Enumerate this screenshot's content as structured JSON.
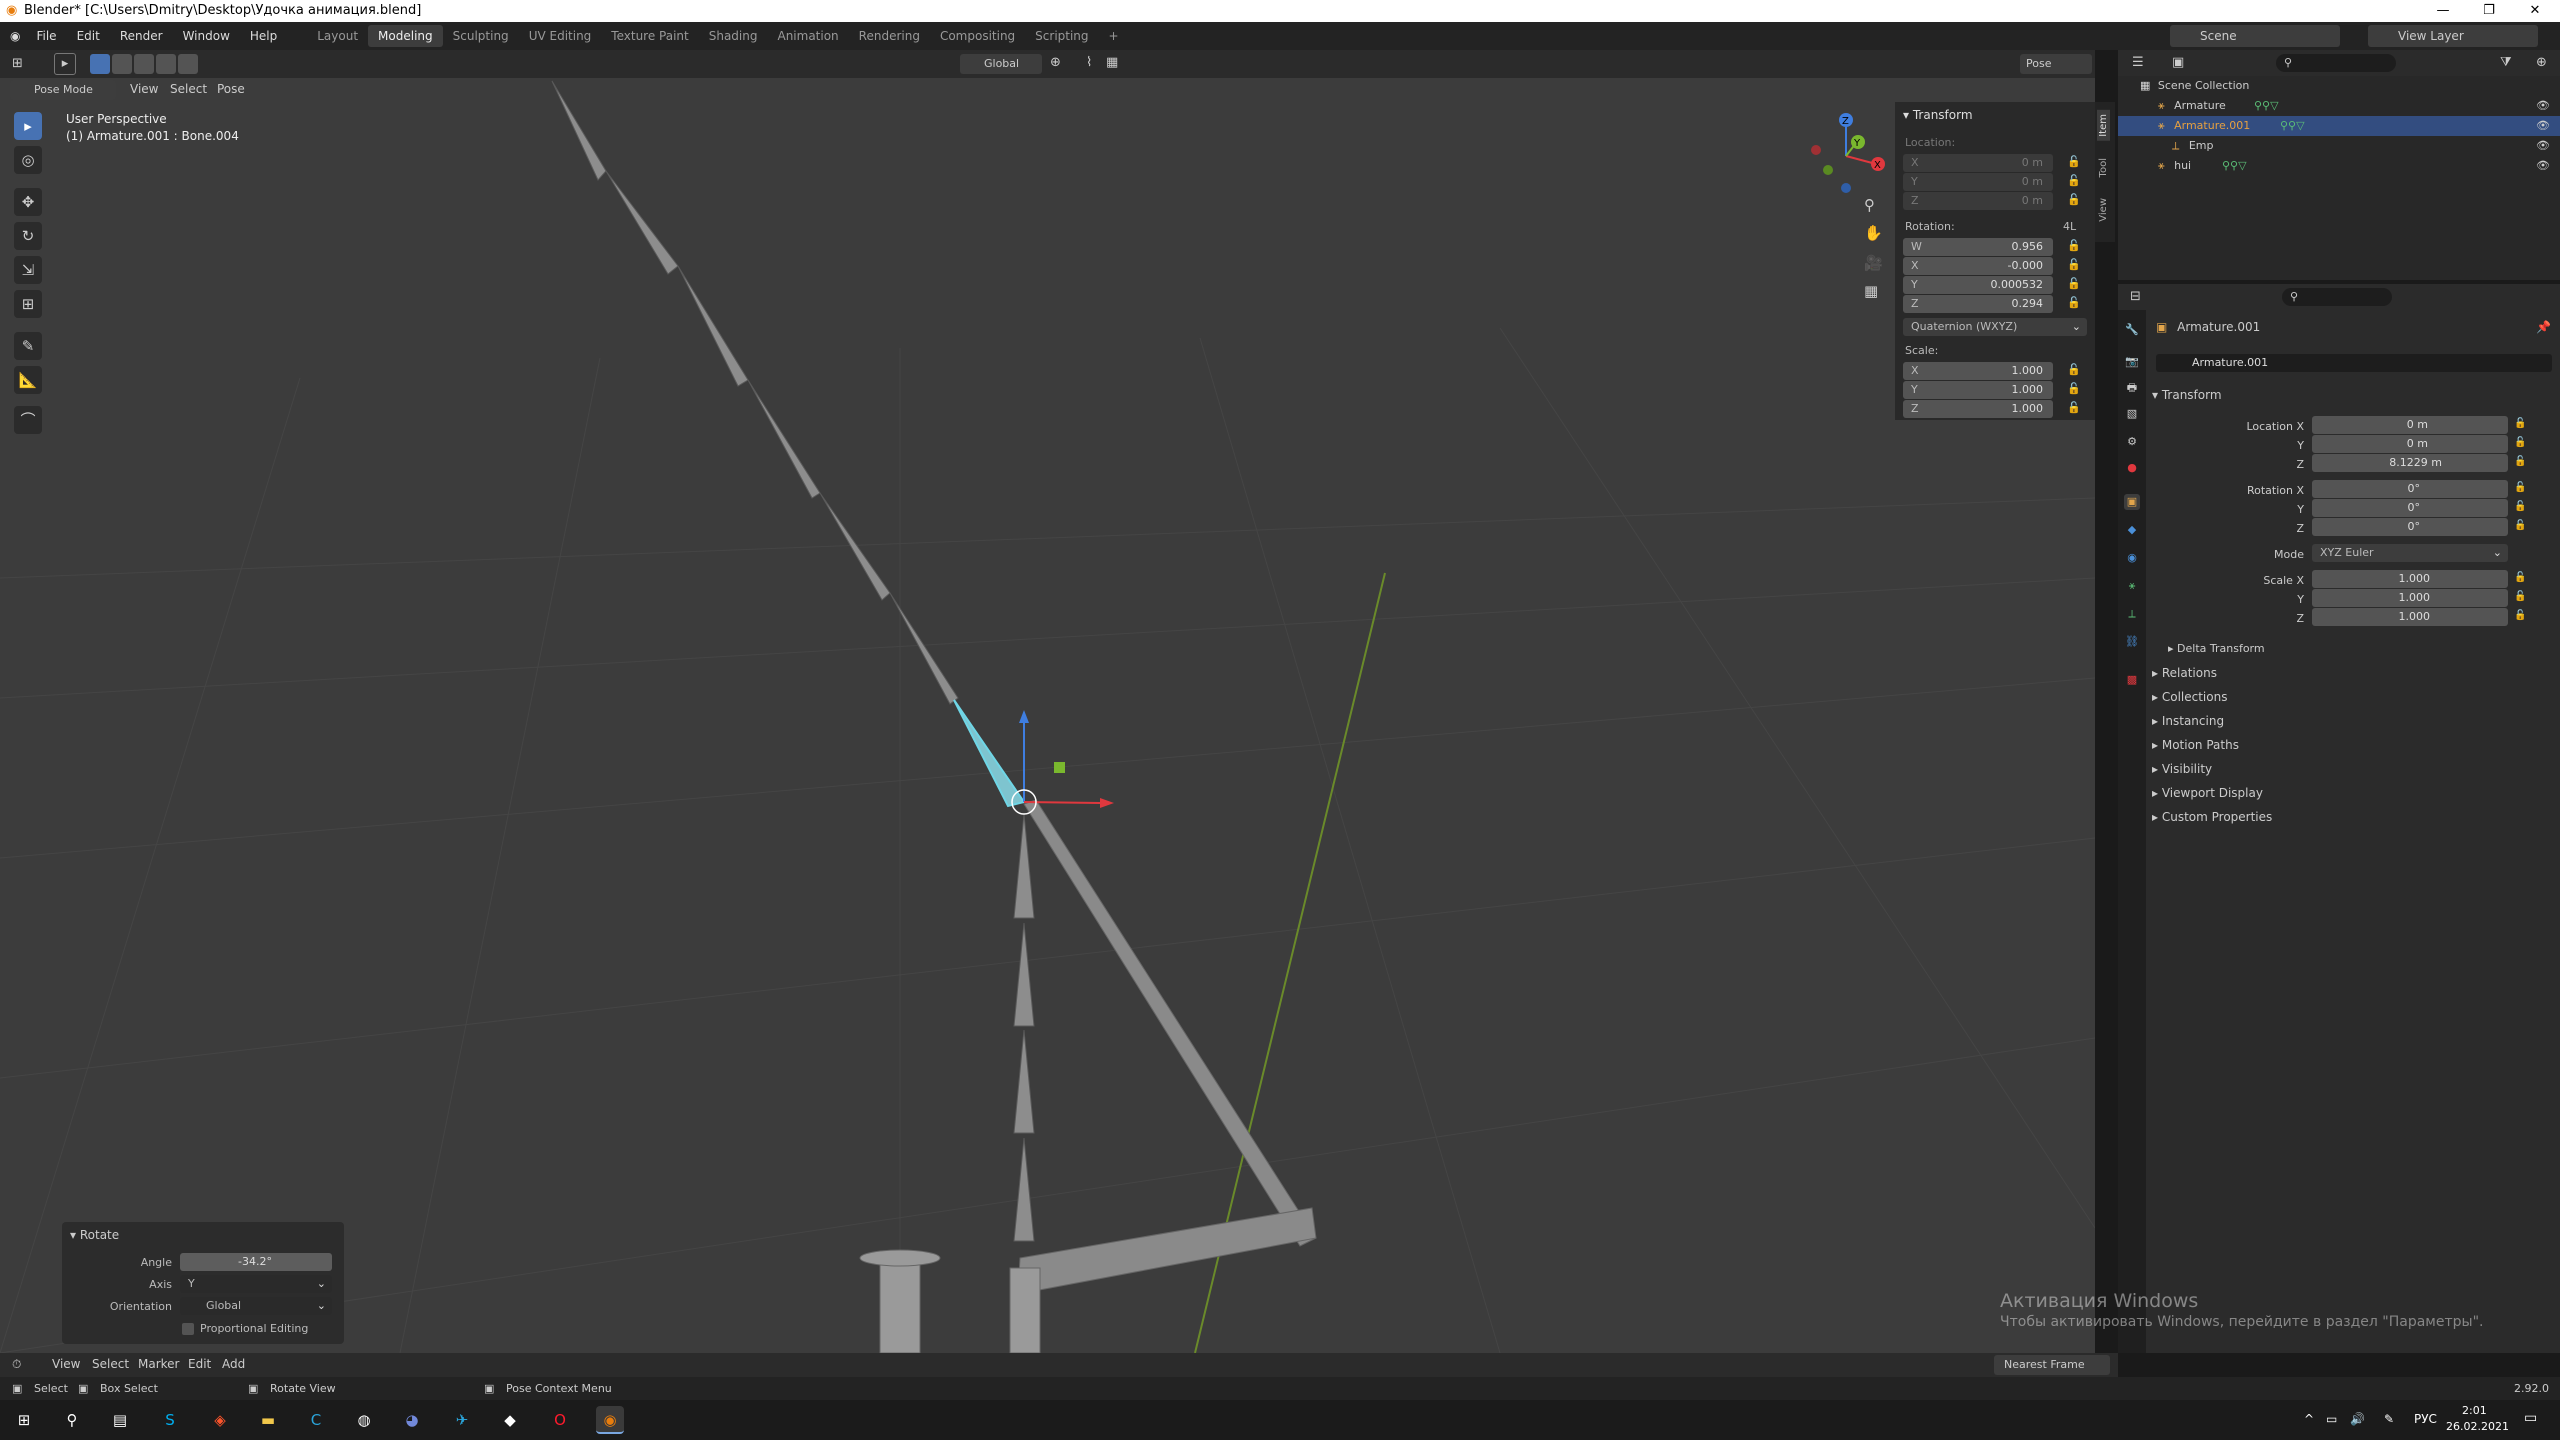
{
  "window": {
    "title": "Blender* [C:\\Users\\Dmitry\\Desktop\\Удочка анимация.blend]"
  },
  "menus": [
    "File",
    "Edit",
    "Render",
    "Window",
    "Help"
  ],
  "workspaces": [
    "Layout",
    "Modeling",
    "Sculpting",
    "UV Editing",
    "Texture Paint",
    "Shading",
    "Animation",
    "Rendering",
    "Compositing",
    "Scripting"
  ],
  "workspace_add": "+",
  "scene": {
    "label": "Scene",
    "view_layer": "View Layer"
  },
  "viewport": {
    "mode": "Pose Mode",
    "header_menus": [
      "View",
      "Select",
      "Pose"
    ],
    "orientation": "Global",
    "pose_options": "Pose Options",
    "overlay_title": "User Perspective",
    "overlay_subtitle": "(1) Armature.001 : Bone.004",
    "gizmo_axes": {
      "z": "Z",
      "y": "Y",
      "x": "X"
    }
  },
  "npanel": {
    "title": "Transform",
    "tabs": [
      "Item",
      "Tool",
      "View"
    ],
    "location_label": "Location:",
    "location": [
      {
        "axis": "X",
        "value": "0 m"
      },
      {
        "axis": "Y",
        "value": "0 m"
      },
      {
        "axis": "Z",
        "value": "0 m"
      }
    ],
    "rotation_label": "Rotation:",
    "rotation_mode_short": "4L",
    "rotation": [
      {
        "axis": "W",
        "value": "0.956"
      },
      {
        "axis": "X",
        "value": "-0.000"
      },
      {
        "axis": "Y",
        "value": "0.000532"
      },
      {
        "axis": "Z",
        "value": "0.294"
      }
    ],
    "rotation_mode": "Quaternion (WXYZ)",
    "scale_label": "Scale:",
    "scale": [
      {
        "axis": "X",
        "value": "1.000"
      },
      {
        "axis": "Y",
        "value": "1.000"
      },
      {
        "axis": "Z",
        "value": "1.000"
      }
    ]
  },
  "outliner": {
    "root": "Scene Collection",
    "items": [
      {
        "name": "Armature",
        "selected": false
      },
      {
        "name": "Armature.001",
        "selected": true
      },
      {
        "name": "Emp",
        "selected": false
      },
      {
        "name": "hui",
        "selected": false
      }
    ]
  },
  "properties": {
    "object_name": "Armature.001",
    "field_name": "Armature.001",
    "transform_title": "Transform",
    "location": [
      {
        "label": "Location X",
        "value": "0 m"
      },
      {
        "label": "Y",
        "value": "0 m"
      },
      {
        "label": "Z",
        "value": "8.1229 m"
      }
    ],
    "rotation": [
      {
        "label": "Rotation X",
        "value": "0°"
      },
      {
        "label": "Y",
        "value": "0°"
      },
      {
        "label": "Z",
        "value": "0°"
      }
    ],
    "mode_label": "Mode",
    "mode_value": "XYZ Euler",
    "scale": [
      {
        "label": "Scale X",
        "value": "1.000"
      },
      {
        "label": "Y",
        "value": "1.000"
      },
      {
        "label": "Z",
        "value": "1.000"
      }
    ],
    "delta": "Delta Transform",
    "sections": [
      "Relations",
      "Collections",
      "Instancing",
      "Motion Paths",
      "Visibility",
      "Viewport Display",
      "Custom Properties"
    ]
  },
  "rotate_panel": {
    "title": "Rotate",
    "angle_label": "Angle",
    "angle_value": "-34.2°",
    "axis_label": "Axis",
    "axis_value": "Y",
    "orientation_label": "Orientation",
    "orientation_value": "Global",
    "proportional": "Proportional Editing"
  },
  "timeline": {
    "menus": [
      "View",
      "Select",
      "Marker",
      "Edit",
      "Add"
    ],
    "snap": "Nearest Frame"
  },
  "status": {
    "select": "Select",
    "box_select": "Box Select",
    "rotate_view": "Rotate View",
    "context_menu": "Pose Context Menu",
    "version": "2.92.0"
  },
  "watermark": {
    "line1": "Активация Windows",
    "line2": "Чтобы активировать Windows, перейдите в раздел \"Параметры\"."
  },
  "taskbar": {
    "lang": "РУС",
    "time": "2:01",
    "date": "26.02.2021"
  },
  "colors": {
    "accent": "#4772b3",
    "bone_selected": "#6fd6e6",
    "x_axis": "#e0383e",
    "y_axis": "#7ab82e",
    "z_axis": "#3f7ee0"
  }
}
